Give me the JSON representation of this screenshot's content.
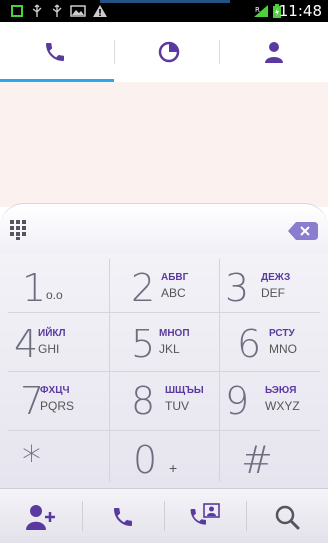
{
  "status_bar": {
    "time": "11:48",
    "icons": [
      "app-notification-icon",
      "usb-icon",
      "usb-icon",
      "image-icon",
      "warning-icon",
      "signal-icon",
      "battery-icon"
    ]
  },
  "tabs": [
    {
      "name": "phone-tab",
      "icon": "phone-icon",
      "selected": true
    },
    {
      "name": "history-tab",
      "icon": "pie-clock-icon",
      "selected": false
    },
    {
      "name": "contacts-tab",
      "icon": "person-icon",
      "selected": false
    }
  ],
  "dial_input": {
    "value": ""
  },
  "keypad": [
    {
      "digit": "1",
      "sub": "o.o",
      "cyr": "",
      "lat": ""
    },
    {
      "digit": "2",
      "sub": "",
      "cyr": "АБВГ",
      "lat": "ABC"
    },
    {
      "digit": "3",
      "sub": "",
      "cyr": "ДЕЖЗ",
      "lat": "DEF"
    },
    {
      "digit": "4",
      "sub": "",
      "cyr": "ИЙКЛ",
      "lat": "GHI"
    },
    {
      "digit": "5",
      "sub": "",
      "cyr": "МНОП",
      "lat": "JKL"
    },
    {
      "digit": "6",
      "sub": "",
      "cyr": "РСТУ",
      "lat": "MNO"
    },
    {
      "digit": "7",
      "sub": "",
      "cyr": "ФХЦЧ",
      "lat": "PQRS"
    },
    {
      "digit": "8",
      "sub": "",
      "cyr": "ШЩЪЫ",
      "lat": "TUV"
    },
    {
      "digit": "9",
      "sub": "",
      "cyr": "ЬЭЮЯ",
      "lat": "WXYZ"
    },
    {
      "digit": "*",
      "sub": "",
      "cyr": "",
      "lat": ""
    },
    {
      "digit": "0",
      "sub": "+",
      "cyr": "",
      "lat": ""
    },
    {
      "digit": "#",
      "sub": "",
      "cyr": "",
      "lat": ""
    }
  ],
  "toolbar": [
    "add-contact-icon",
    "call-icon",
    "video-call-icon",
    "search-icon"
  ],
  "colors": {
    "accent": "#2fa6e8",
    "icon_purple": "#5b3aa0",
    "display_bg": "#fbf1ee",
    "delete_key": "#8a7ccf"
  }
}
